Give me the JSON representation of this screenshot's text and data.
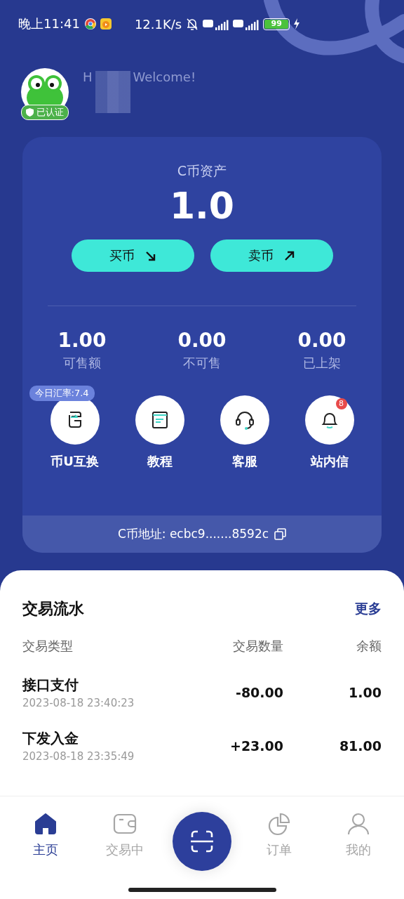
{
  "status_bar": {
    "time": "晚上11:41",
    "speed": "12.1K/s",
    "battery": "99"
  },
  "header": {
    "verified_badge": "已认证",
    "greeting_start": "H",
    "greeting_end": "Welcome!"
  },
  "asset_card": {
    "title": "C币资产",
    "amount": "1.0",
    "buttons": [
      {
        "label": "买币",
        "kind": "buy"
      },
      {
        "label": "卖币",
        "kind": "sell"
      }
    ],
    "stats": [
      {
        "value": "1.00",
        "label": "可售额"
      },
      {
        "value": "0.00",
        "label": "不可售"
      },
      {
        "value": "0.00",
        "label": "已上架"
      }
    ],
    "actions": [
      {
        "label": "币U互换",
        "kind": "exchange",
        "tag": "今日汇率:7.4"
      },
      {
        "label": "教程",
        "kind": "tutorial"
      },
      {
        "label": "客服",
        "kind": "service"
      },
      {
        "label": "站内信",
        "kind": "messages",
        "badge": "8"
      }
    ],
    "address": "C币地址: ecbc9.......8592c"
  },
  "transactions": {
    "title": "交易流水",
    "more": "更多",
    "columns": [
      "交易类型",
      "交易数量",
      "余额"
    ],
    "rows": [
      {
        "type": "接口支付",
        "time": "2023-08-18 23:40:23",
        "amount": "-80.00",
        "balance": "1.00"
      },
      {
        "type": "下发入金",
        "time": "2023-08-18 23:35:49",
        "amount": "+23.00",
        "balance": "81.00"
      }
    ]
  },
  "tab_bar": {
    "tabs": [
      {
        "label": "主页",
        "kind": "home",
        "selected": true
      },
      {
        "label": "交易中",
        "kind": "wallet",
        "selected": false
      },
      {
        "kind": "scan",
        "selected": false
      },
      {
        "label": "订单",
        "kind": "orders",
        "selected": false
      },
      {
        "label": "我的",
        "kind": "profile",
        "selected": false
      }
    ]
  }
}
